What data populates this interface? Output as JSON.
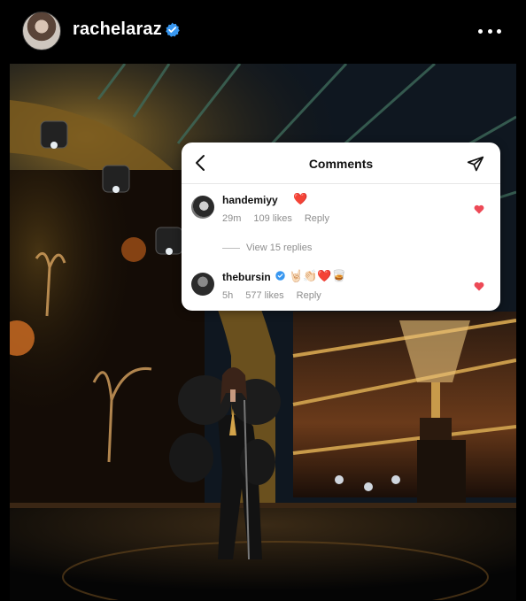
{
  "header": {
    "username": "rachelaraz",
    "avatar_icon": "profile-photo",
    "verified_icon": "verified-badge-icon",
    "more_icon": "more-options-icon"
  },
  "comments_panel": {
    "title": "Comments",
    "back_icon": "chevron-left-icon",
    "share_icon": "paper-plane-icon",
    "comments": [
      {
        "username": "handemiyy",
        "text": "❤️",
        "time": "29m",
        "likes": "109 likes",
        "reply_label": "Reply",
        "liked": true
      },
      {
        "username": "thebursin",
        "verified": true,
        "text": "🤘🏻👏🏻❤️🥃",
        "time": "5h",
        "likes": "577 likes",
        "reply_label": "Reply",
        "liked": true
      }
    ],
    "view_replies_label": "View 15 replies"
  },
  "colors": {
    "background": "#000000",
    "verified_blue": "#3897f0",
    "heart_red": "#ed4956",
    "meta_gray": "#8e8e8e"
  }
}
